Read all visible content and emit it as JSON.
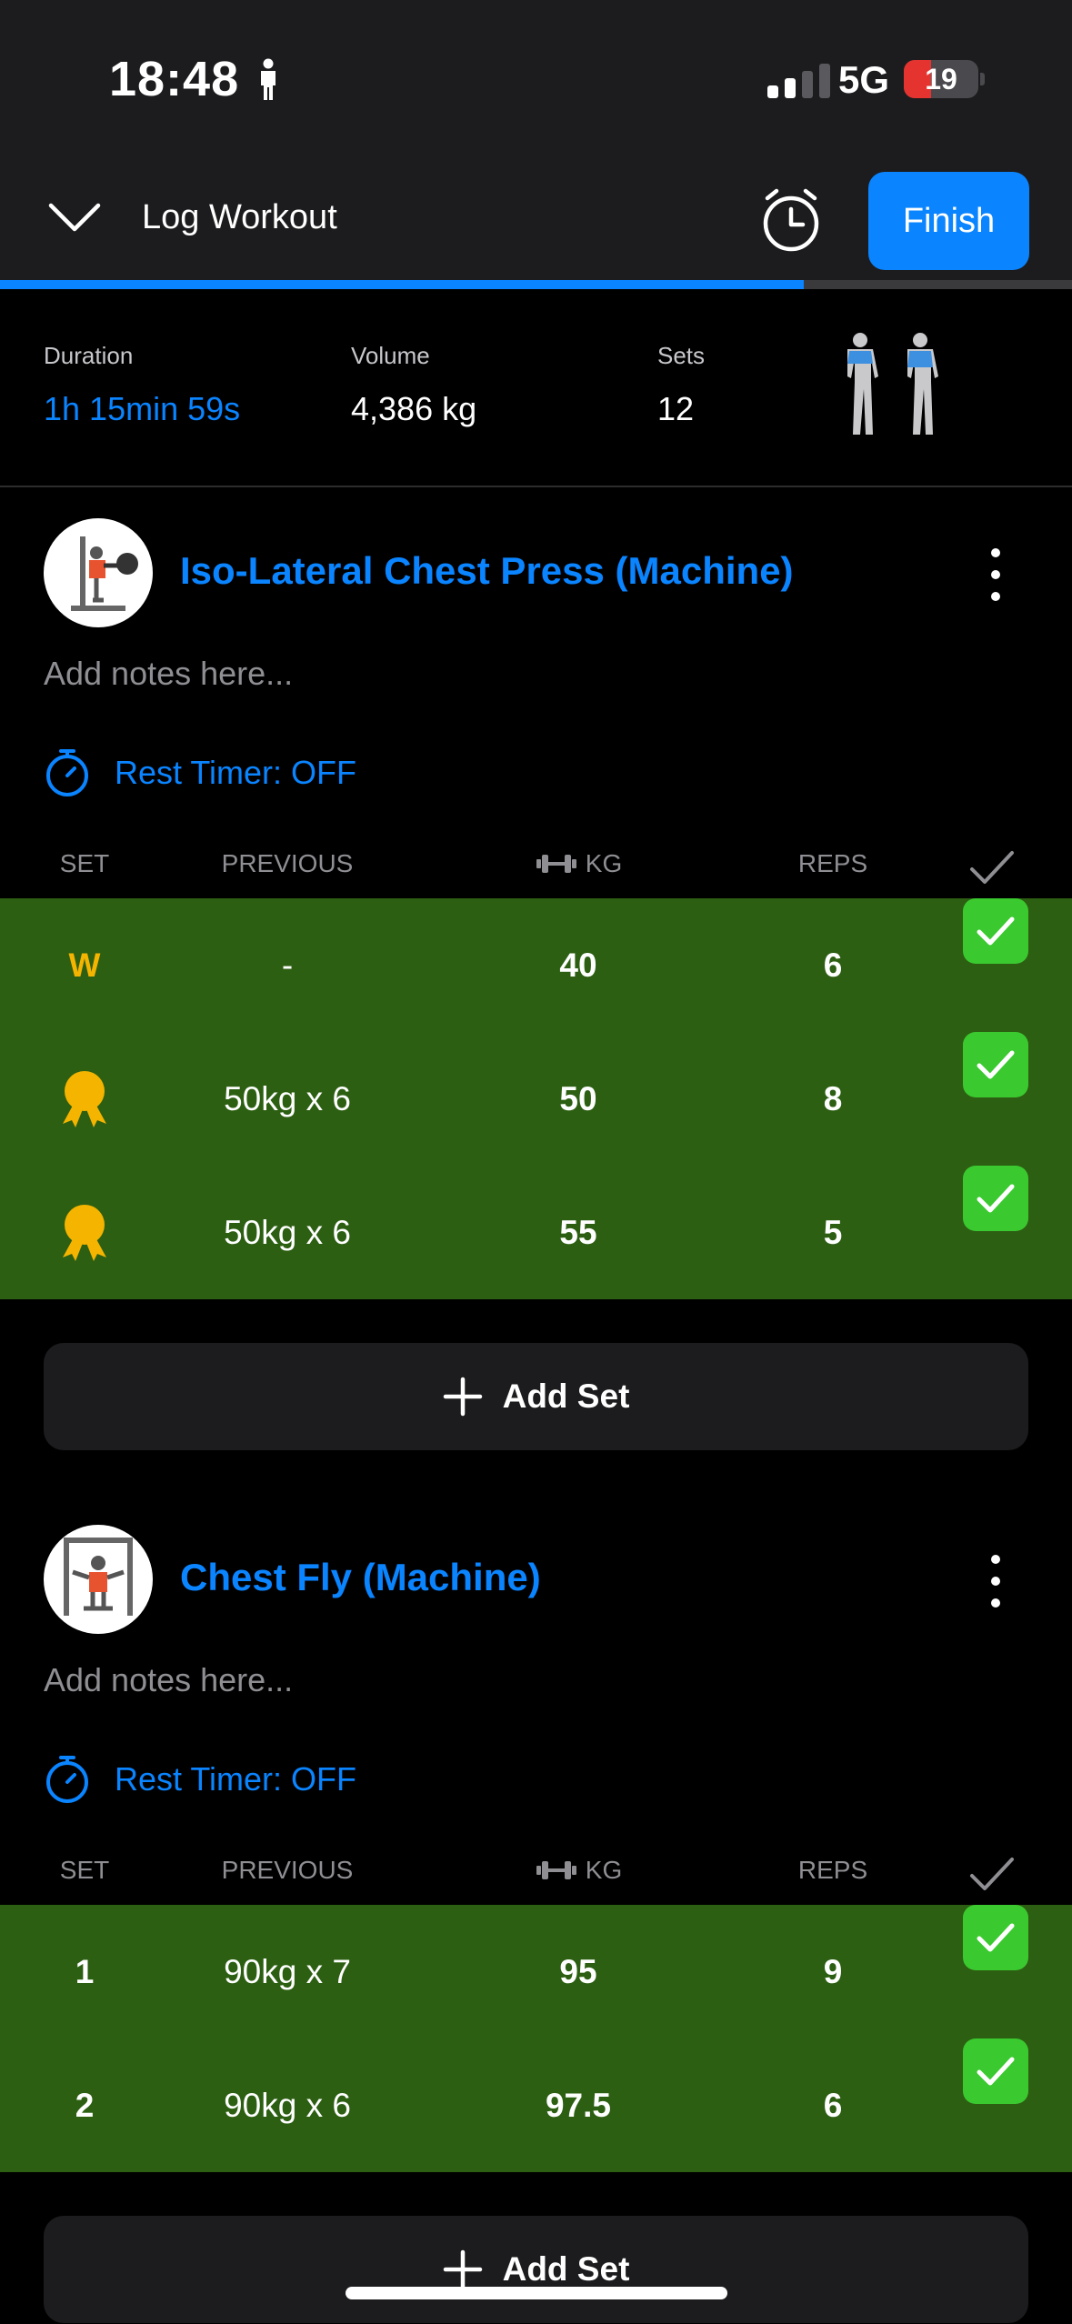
{
  "status_bar": {
    "time": "18:48",
    "network": "5G",
    "battery": "19"
  },
  "header": {
    "title": "Log Workout",
    "finish_label": "Finish",
    "progress": 0.75
  },
  "stats": {
    "duration_label": "Duration",
    "duration_value": "1h 15min 59s",
    "volume_label": "Volume",
    "volume_value": "4,386 kg",
    "sets_label": "Sets",
    "sets_value": "12"
  },
  "columns": {
    "set": "SET",
    "previous": "PREVIOUS",
    "kg": "KG",
    "reps": "REPS"
  },
  "exercises": [
    {
      "name": "Iso-Lateral Chest Press (Machine)",
      "notes_placeholder": "Add notes here...",
      "rest_timer": "Rest Timer: OFF",
      "sets": [
        {
          "set": "W",
          "type": "warmup",
          "previous": "-",
          "kg": "40",
          "reps": "6",
          "done": true
        },
        {
          "set": "",
          "type": "record",
          "previous": "50kg x 6",
          "kg": "50",
          "reps": "8",
          "done": true
        },
        {
          "set": "",
          "type": "record",
          "previous": "50kg x 6",
          "kg": "55",
          "reps": "5",
          "done": true
        }
      ],
      "add_set_label": "Add Set"
    },
    {
      "name": "Chest Fly (Machine)",
      "notes_placeholder": "Add notes here...",
      "rest_timer": "Rest Timer: OFF",
      "sets": [
        {
          "set": "1",
          "type": "normal",
          "previous": "90kg x 7",
          "kg": "95",
          "reps": "9",
          "done": true
        },
        {
          "set": "2",
          "type": "normal",
          "previous": "90kg x 6",
          "kg": "97.5",
          "reps": "6",
          "done": true
        }
      ],
      "add_set_label": "Add Set"
    }
  ],
  "colors": {
    "accent": "#0a84ff",
    "completed_row": "#2c5f12",
    "check": "#3ac92f",
    "warmup": "#f5b400"
  }
}
